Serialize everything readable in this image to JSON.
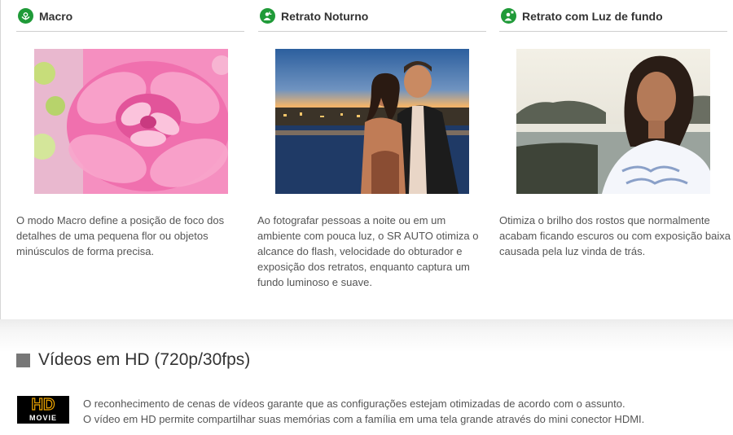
{
  "features": [
    {
      "title": "Macro",
      "icon": "flower-macro-icon",
      "description": "O modo Macro define a posição de foco dos detalhes de uma pequena flor ou objetos minúsculos de forma precisa."
    },
    {
      "title": "Retrato Noturno",
      "icon": "night-portrait-icon",
      "description": "Ao fotografar pessoas a noite ou em um ambiente com pouca luz, o SR AUTO otimiza o alcance do flash, velocidade do obturador e exposição dos retratos, enquanto captura um fundo luminoso e suave."
    },
    {
      "title": "Retrato com Luz de fundo",
      "icon": "backlight-portrait-icon",
      "description": "Otimiza o brilho dos rostos que normalmente acabam ficando escuros ou com exposição baixa causada pela luz vinda de trás."
    }
  ],
  "video_section": {
    "title": "Vídeos em HD (720p/30fps)",
    "badge_top": "HD",
    "badge_bottom": "MOVIE",
    "lines": [
      "O reconhecimento de cenas de vídeos garante que as configurações estejam otimizadas de acordo com o assunto.",
      "O vídeo em HD permite compartilhar suas memórias com a família em uma tela grande através do mini conector HDMI."
    ]
  },
  "colors": {
    "icon_green": "#1f9a38",
    "badge_gold": "#f0a500"
  }
}
